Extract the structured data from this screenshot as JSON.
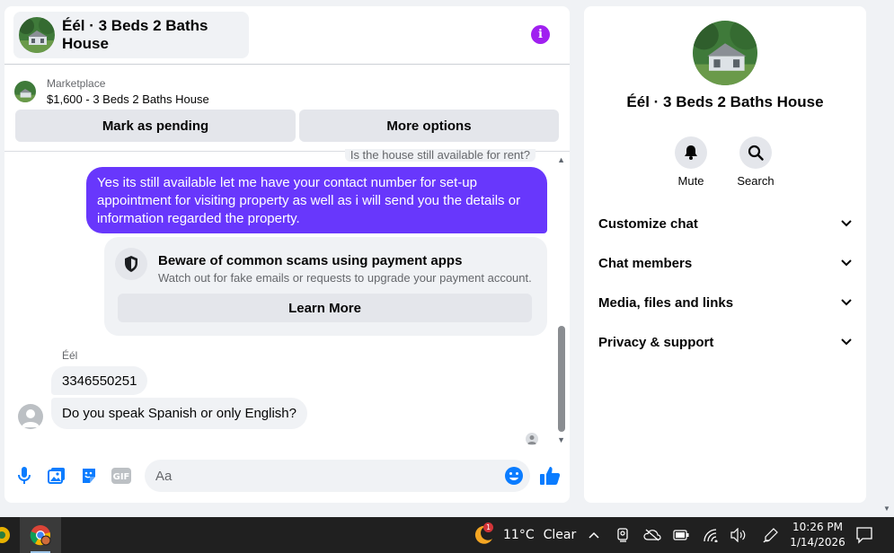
{
  "chat": {
    "title": "Éél · 3 Beds 2 Baths House",
    "marketplace_label": "Marketplace",
    "listing": "$1,600 - 3 Beds 2 Baths House",
    "mark_pending_label": "Mark as pending",
    "more_options_label": "More options"
  },
  "messages": {
    "previous": "Is the house still available for rent?",
    "sent": "Yes its still available let me have your contact number for set-up appointment for visiting property as well as i will send you the details or information regarded the property.",
    "scam_title": "Beware of common scams using payment apps",
    "scam_subtitle": "Watch out for fake emails or requests to upgrade your payment account.",
    "learn_more": "Learn More",
    "sender": "Éél",
    "received": [
      "3346550251",
      "Do you speak Spanish or only English?"
    ]
  },
  "composer": {
    "placeholder": "Aa"
  },
  "info_panel": {
    "title": "Éél · 3 Beds 2 Baths House",
    "mute_label": "Mute",
    "search_label": "Search",
    "sections": [
      "Customize chat",
      "Chat members",
      "Media, files and links",
      "Privacy & support"
    ]
  },
  "taskbar": {
    "weather_badge": "1",
    "temperature": "11°C",
    "condition": "Clear",
    "time": "10:26 PM",
    "date": "1/14/2026"
  },
  "colors": {
    "accent": "#6837fc",
    "info": "#a020f0",
    "messenger_blue": "#0a7cff"
  }
}
